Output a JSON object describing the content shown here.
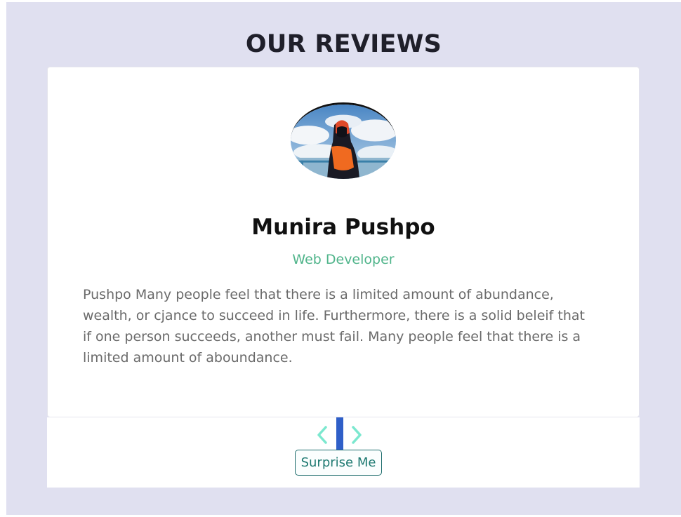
{
  "header": {
    "title": "OUR REVIEWS"
  },
  "review": {
    "name": "Munira Pushpo",
    "job": "Web Developer",
    "text": "Pushpo Many people feel that there is a limited amount of abundance, wealth, or cjance to succeed in life. Furthermore, there is a solid beleif that if one person succeeds, another must fail. Many people feel that there is a limited amount of aboundance."
  },
  "controls": {
    "prev_icon": "chevron-left-icon",
    "next_icon": "chevron-right-icon",
    "surprise_label": "Surprise Me"
  },
  "colors": {
    "page_background": "#e0e0f0",
    "job_accent": "#4fb48a",
    "chevron": "#7ce8cf",
    "button_text": "#1f7a72",
    "focus_bar": "#2f5fc8"
  }
}
